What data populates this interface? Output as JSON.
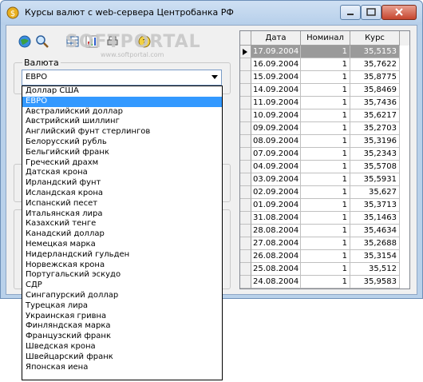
{
  "window": {
    "title": "Курсы валют с web-сервера Центробанка РФ"
  },
  "watermark": {
    "logo": "SOFTPORTAL",
    "url": "www.softportal.com"
  },
  "currency_group": {
    "label": "Валюта",
    "selected": "ЕВРО"
  },
  "dropdown": {
    "items": [
      "Доллар США",
      "ЕВРО",
      "Австралийский доллар",
      "Австрийский шиллинг",
      "Английский фунт стерлингов",
      "Белорусский рубль",
      "Бельгийский франк",
      "Греческий драхм",
      "Датская крона",
      "Ирландский фунт",
      "Исландская крона",
      "Испанский песет",
      "Итальянская лира",
      "Казахский тенге",
      "Канадский доллар",
      "Немецкая марка",
      "Нидерландский гульден",
      "Норвежская крона",
      "Португальский эскудо",
      "СДР",
      "Сингапурский доллар",
      "Турецкая лира",
      "Украинская гривна",
      "Финляндская марка",
      "Французский франк",
      "Шведская крона",
      "Швейцарский франк",
      "Японская иена"
    ],
    "selected_index": 1
  },
  "grid": {
    "columns": [
      "Дата",
      "Номинал",
      "Курс"
    ],
    "selected_row": 0,
    "rows": [
      {
        "date": "17.09.2004",
        "nominal": "1",
        "rate": "35,5153"
      },
      {
        "date": "16.09.2004",
        "nominal": "1",
        "rate": "35,7622"
      },
      {
        "date": "15.09.2004",
        "nominal": "1",
        "rate": "35,8775"
      },
      {
        "date": "14.09.2004",
        "nominal": "1",
        "rate": "35,8469"
      },
      {
        "date": "11.09.2004",
        "nominal": "1",
        "rate": "35,7436"
      },
      {
        "date": "10.09.2004",
        "nominal": "1",
        "rate": "35,6217"
      },
      {
        "date": "09.09.2004",
        "nominal": "1",
        "rate": "35,2703"
      },
      {
        "date": "08.09.2004",
        "nominal": "1",
        "rate": "35,3196"
      },
      {
        "date": "07.09.2004",
        "nominal": "1",
        "rate": "35,2343"
      },
      {
        "date": "04.09.2004",
        "nominal": "1",
        "rate": "35,5708"
      },
      {
        "date": "03.09.2004",
        "nominal": "1",
        "rate": "35,5931"
      },
      {
        "date": "02.09.2004",
        "nominal": "1",
        "rate": "35,627"
      },
      {
        "date": "01.09.2004",
        "nominal": "1",
        "rate": "35,3713"
      },
      {
        "date": "31.08.2004",
        "nominal": "1",
        "rate": "35,1463"
      },
      {
        "date": "28.08.2004",
        "nominal": "1",
        "rate": "35,4634"
      },
      {
        "date": "27.08.2004",
        "nominal": "1",
        "rate": "35,2688"
      },
      {
        "date": "26.08.2004",
        "nominal": "1",
        "rate": "35,3154"
      },
      {
        "date": "25.08.2004",
        "nominal": "1",
        "rate": "35,512"
      },
      {
        "date": "24.08.2004",
        "nominal": "1",
        "rate": "35,9583"
      }
    ]
  },
  "colors": {
    "selection": "#3399ff",
    "grid_selected_row": "#9a9a9a",
    "window_frame": "#b9d1ea"
  }
}
